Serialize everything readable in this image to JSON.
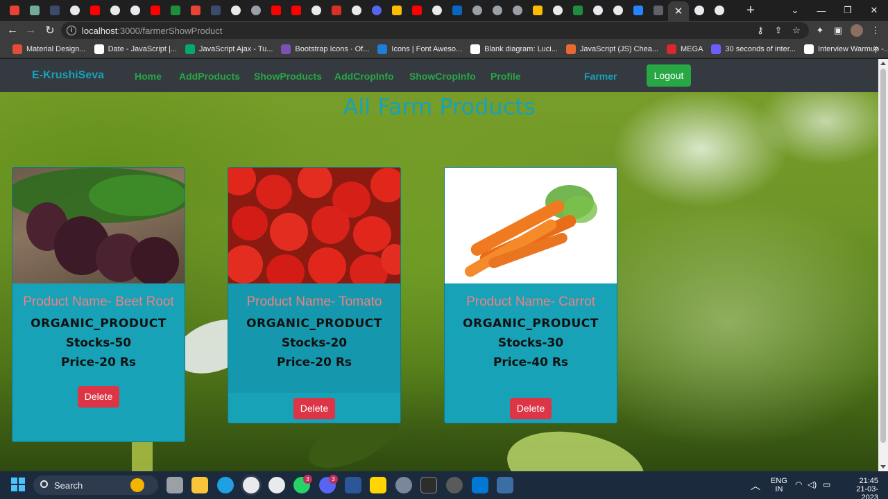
{
  "browser": {
    "url_host": "localhost",
    "url_path": ":3000/farmerShowProduct",
    "new_tab_label": "+",
    "close_tab_label": "✕",
    "bookmarks": [
      {
        "label": "Material Design...",
        "color": "#e04e39"
      },
      {
        "label": "Date - JavaScript |...",
        "color": "#ffffff"
      },
      {
        "label": "JavaScript Ajax - Tu...",
        "color": "#04aa6d"
      },
      {
        "label": "Bootstrap Icons · Of...",
        "color": "#7952b3"
      },
      {
        "label": "Icons | Font Aweso...",
        "color": "#1c7ed6"
      },
      {
        "label": "Blank diagram: Luci...",
        "color": "#ffffff"
      },
      {
        "label": "JavaScript (JS) Chea...",
        "color": "#e86a33"
      },
      {
        "label": "MEGA",
        "color": "#d9272e"
      },
      {
        "label": "30 seconds of inter...",
        "color": "#6d5dfc"
      },
      {
        "label": "Interview Warmup -...",
        "color": "#ffffff"
      }
    ],
    "bookmarks_more": "»"
  },
  "app": {
    "brand": "E-KrushiSeva",
    "nav": [
      {
        "label": "Home"
      },
      {
        "label": "AddProducts"
      },
      {
        "label": "ShowProducts"
      },
      {
        "label": "AddCropInfo"
      },
      {
        "label": "ShowCropInfo"
      },
      {
        "label": "Profile"
      }
    ],
    "role": "Farmer",
    "logout_label": "Logout",
    "page_title": "All Farm Products"
  },
  "products": [
    {
      "name": "Product Name- Beet Root",
      "type": "ORGANIC_PRODUCT",
      "stock": "Stocks-50",
      "price": "Price-20 Rs",
      "delete_label": "Delete"
    },
    {
      "name": "Product Name- Tomato",
      "type": "ORGANIC_PRODUCT",
      "stock": "Stocks-20",
      "price": "Price-20 Rs",
      "delete_label": "Delete"
    },
    {
      "name": "Product Name- Carrot",
      "type": "ORGANIC_PRODUCT",
      "stock": "Stocks-30",
      "price": "Price-40 Rs",
      "delete_label": "Delete"
    }
  ],
  "taskbar": {
    "search_label": "Search",
    "lang_top": "ENG",
    "lang_bottom": "IN",
    "time": "21:45",
    "date": "21-03-2023",
    "badge_a": "3",
    "badge_b": "3"
  },
  "colors": {
    "navbar": "#343a40",
    "brand": "#17a2b8",
    "nav_link": "#28a745",
    "card": "#17a2b8",
    "product_name": "#f08080",
    "delete": "#dc3545",
    "logout": "#28a745"
  }
}
